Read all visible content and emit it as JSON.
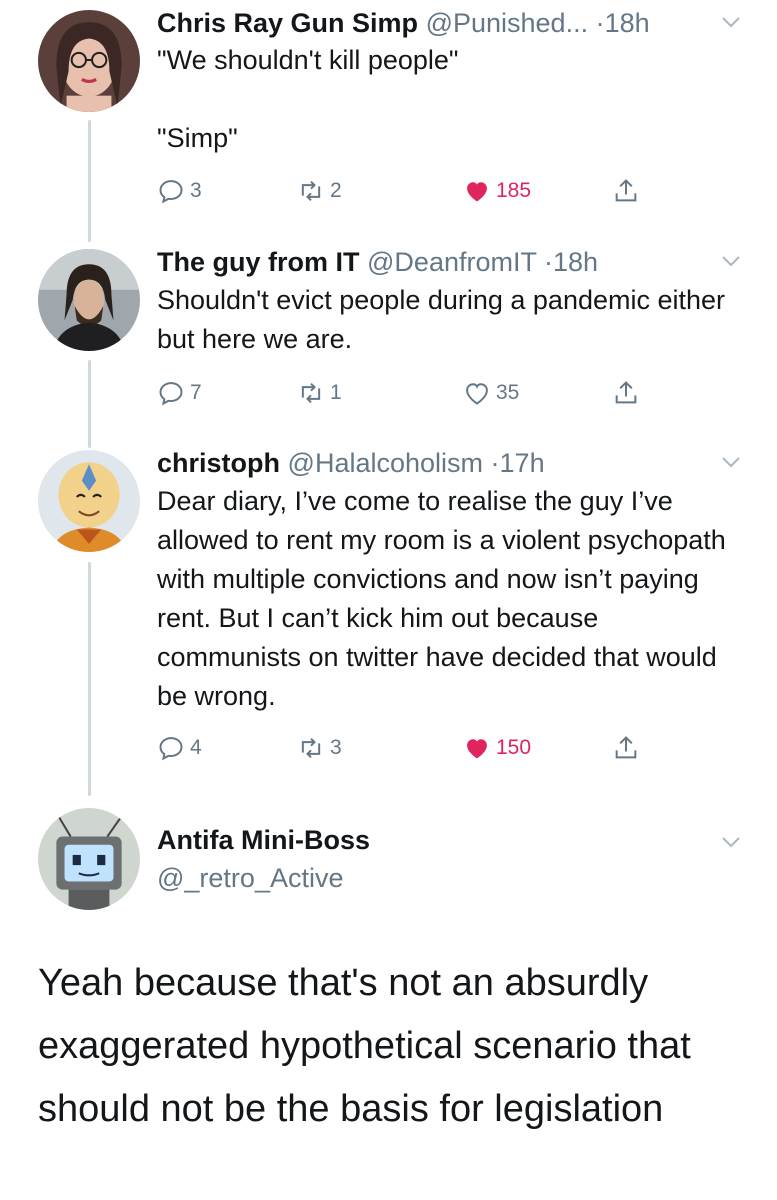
{
  "tweets": [
    {
      "name": "Chris Ray Gun Simp",
      "handle": "@Punished...",
      "time": "18h",
      "body": "\"We shouldn't kill people\"\n\n\"Simp\"",
      "replies": "3",
      "retweets": "2",
      "likes": "185",
      "liked": true
    },
    {
      "name": "The guy from IT",
      "handle": "@DeanfromIT",
      "time": "18h",
      "body": "Shouldn't evict people during a pandemic either but here we are.",
      "replies": "7",
      "retweets": "1",
      "likes": "35",
      "liked": false
    },
    {
      "name": "christoph",
      "handle": "@Halalcoholism",
      "time": "17h",
      "body": "Dear diary, I’ve come to realise the guy I’ve allowed to rent my room is a violent psychopath with multiple convictions and now isn’t paying rent. But I can’t kick him out because communists on twitter have decided that would be wrong.",
      "replies": "4",
      "retweets": "3",
      "likes": "150",
      "liked": true
    }
  ],
  "main_tweet": {
    "name": "Antifa Mini-Boss",
    "handle": "@_retro_Active",
    "body": "Yeah because that's not an absurdly exaggerated hypothetical scenario that should not be the basis for legislation"
  },
  "separator": "·",
  "icons": {
    "reply": "reply-icon",
    "retweet": "retweet-icon",
    "like": "heart-icon",
    "share": "share-icon",
    "more": "chevron-down-icon"
  },
  "colors": {
    "like_active": "#e0245e",
    "secondary_text": "#657786",
    "thread_line": "#cfd9de"
  }
}
